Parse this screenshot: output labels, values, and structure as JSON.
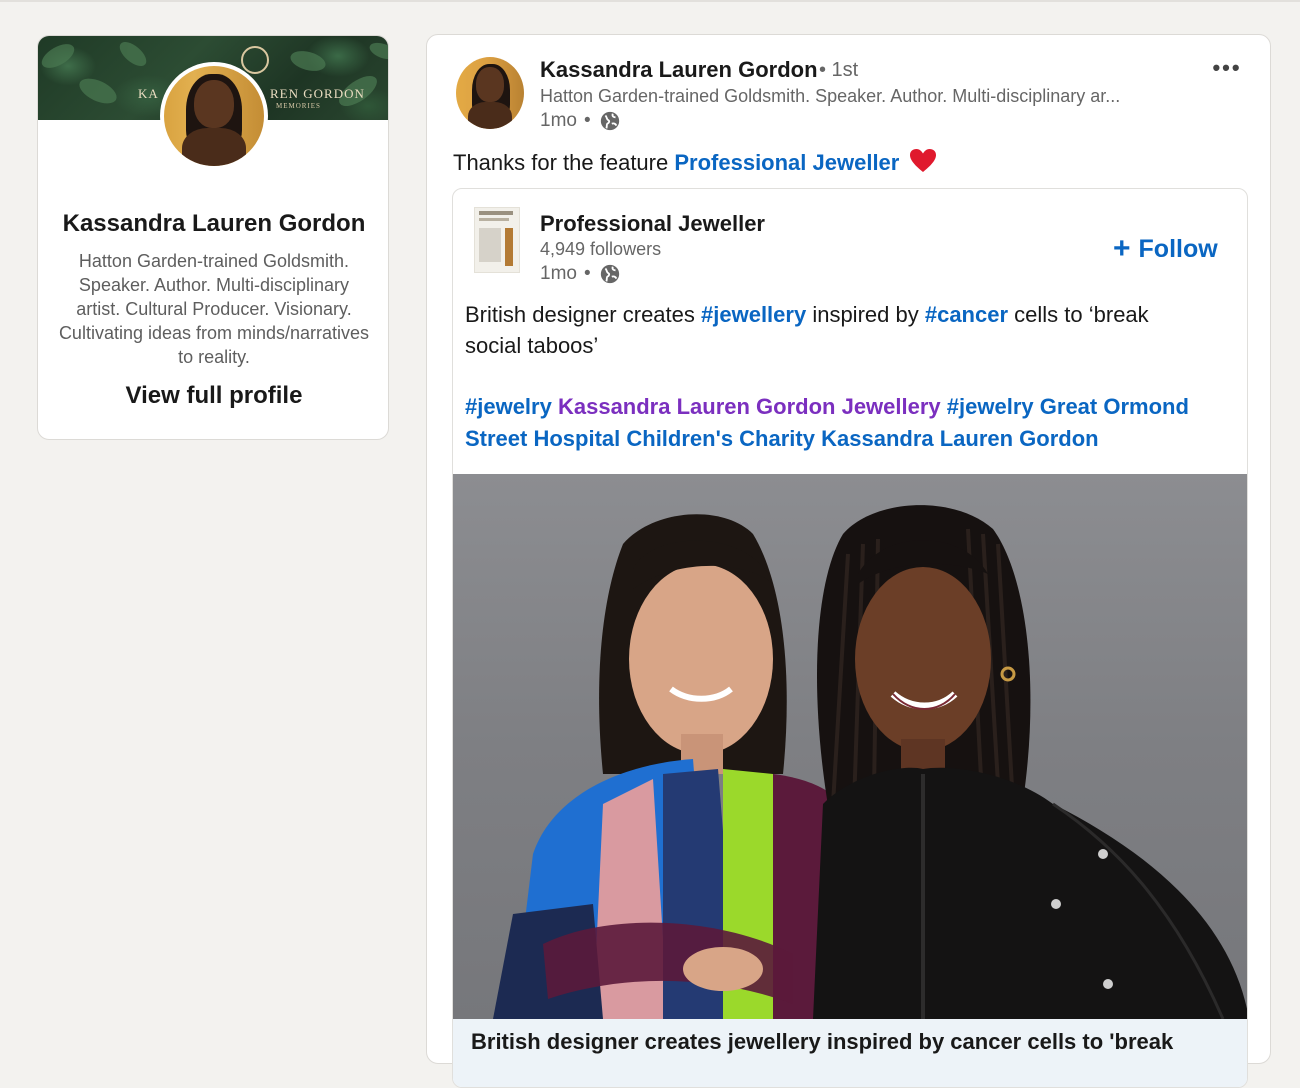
{
  "profile_card": {
    "name": "Kassandra Lauren Gordon",
    "headline": "Hatton Garden-trained Goldsmith. Speaker. Author. Multi-disciplinary artist. Cultural Producer. Visionary. Cultivating ideas from minds/narratives to reality.",
    "view_profile_label": "View full profile",
    "cover_text_left": "KA",
    "cover_text_right": "REN GORDON",
    "cover_subtext": "MEMORIES"
  },
  "post": {
    "author_name": "Kassandra Lauren Gordon",
    "connection_degree": "• 1st",
    "author_headline": "Hatton Garden-trained Goldsmith. Speaker. Author. Multi-disciplinary ar...",
    "time": "1mo",
    "visibility_icon": "globe-icon",
    "more_label": "•••",
    "text_prefix": "Thanks for the feature",
    "mention": "Professional Jeweller",
    "emoji_icon": "red-heart-icon"
  },
  "reshare": {
    "org_name": "Professional Jeweller",
    "followers": "4,949 followers",
    "time": "1mo",
    "follow_label": "Follow",
    "follow_icon": "plus-icon",
    "body": {
      "t1": "British designer creates",
      "tag1": "#jewellery",
      "t2": "inspired by",
      "tag2": "#cancer",
      "t3": "cells to ‘break social taboos’"
    },
    "tags": {
      "tag_jewelry_1": "#jewelry",
      "brand": "Kassandra Lauren Gordon Jewellery",
      "tag_jewelry_2": "#jewelry",
      "charity": "Great Ormond Street Hospital Children's Charity",
      "person": "Kassandra Lauren Gordon"
    },
    "image_alt": "Two women smiling in front of a grey backdrop",
    "caption": "British designer creates jewellery inspired by cancer cells to 'break"
  },
  "colors": {
    "background": "#f3f2ef",
    "link_blue": "#0a66c2",
    "hashtag_purple": "#7b2fbf",
    "muted_text": "#666666"
  }
}
